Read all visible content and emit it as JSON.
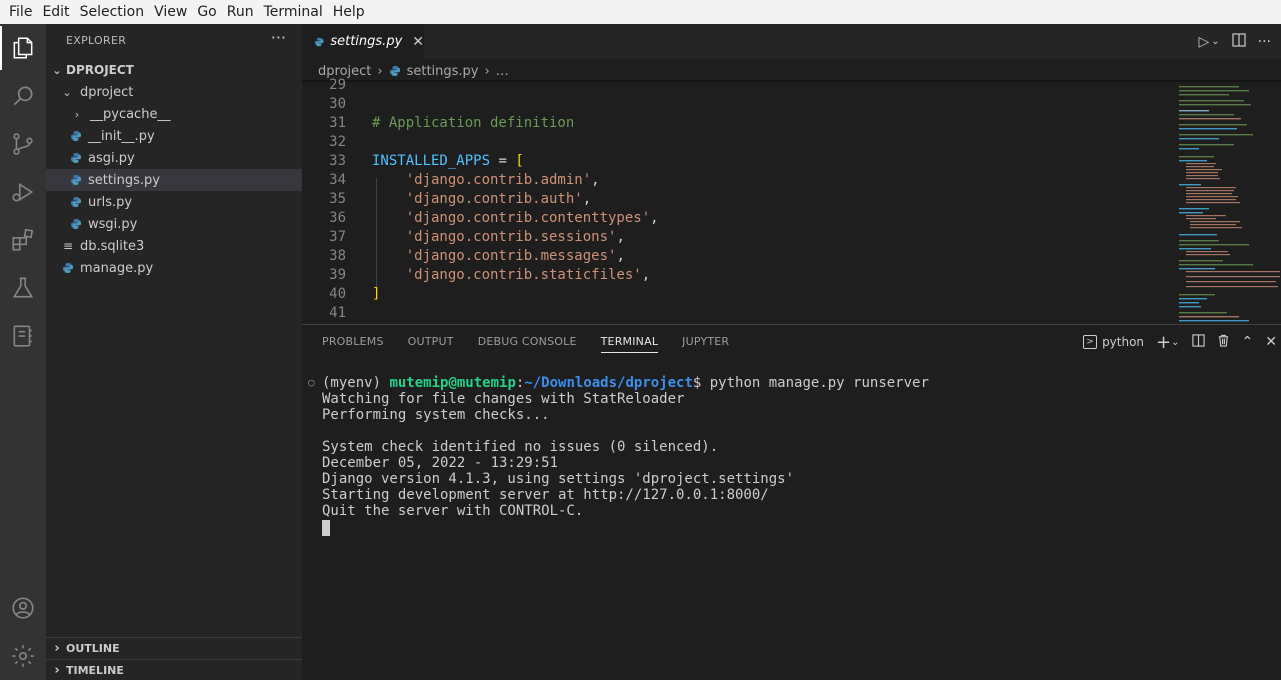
{
  "menu": [
    "File",
    "Edit",
    "Selection",
    "View",
    "Go",
    "Run",
    "Terminal",
    "Help"
  ],
  "activity_bar": {
    "top_icons": [
      "explorer-icon",
      "search-icon",
      "source-control-icon",
      "run-debug-icon",
      "extensions-icon",
      "testing-icon",
      "notebook-icon"
    ],
    "bottom_icons": [
      "account-icon",
      "gear-icon"
    ]
  },
  "sidebar": {
    "title": "EXPLORER",
    "more": "···",
    "root": "DPROJECT",
    "items": [
      {
        "label": "dproject",
        "kind": "folder-open"
      },
      {
        "label": "__pycache__",
        "kind": "folder-closed"
      },
      {
        "label": "__init__.py",
        "kind": "python"
      },
      {
        "label": "asgi.py",
        "kind": "python"
      },
      {
        "label": "settings.py",
        "kind": "python"
      },
      {
        "label": "urls.py",
        "kind": "python"
      },
      {
        "label": "wsgi.py",
        "kind": "python"
      },
      {
        "label": "db.sqlite3",
        "kind": "file"
      },
      {
        "label": "manage.py",
        "kind": "python"
      }
    ],
    "outline": "OUTLINE",
    "timeline": "TIMELINE"
  },
  "editor": {
    "tab_label": "settings.py",
    "breadcrumb": [
      "dproject",
      "settings.py",
      "…"
    ],
    "lines": [
      {
        "n": "29",
        "parts": []
      },
      {
        "n": "30",
        "parts": []
      },
      {
        "n": "31",
        "parts": [
          [
            "comment",
            "# Application definition"
          ]
        ]
      },
      {
        "n": "32",
        "parts": []
      },
      {
        "n": "33",
        "parts": [
          [
            "var",
            "INSTALLED_APPS"
          ],
          [
            "op",
            " = "
          ],
          [
            "bracket",
            "["
          ]
        ]
      },
      {
        "n": "34",
        "parts": [
          [
            "op",
            "    "
          ],
          [
            "str",
            "'django.contrib.admin'"
          ],
          [
            "op",
            ","
          ]
        ]
      },
      {
        "n": "35",
        "parts": [
          [
            "op",
            "    "
          ],
          [
            "str",
            "'django.contrib.auth'"
          ],
          [
            "op",
            ","
          ]
        ]
      },
      {
        "n": "36",
        "parts": [
          [
            "op",
            "    "
          ],
          [
            "str",
            "'django.contrib.contenttypes'"
          ],
          [
            "op",
            ","
          ]
        ]
      },
      {
        "n": "37",
        "parts": [
          [
            "op",
            "    "
          ],
          [
            "str",
            "'django.contrib.sessions'"
          ],
          [
            "op",
            ","
          ]
        ]
      },
      {
        "n": "38",
        "parts": [
          [
            "op",
            "    "
          ],
          [
            "str",
            "'django.contrib.messages'"
          ],
          [
            "op",
            ","
          ]
        ]
      },
      {
        "n": "39",
        "parts": [
          [
            "op",
            "    "
          ],
          [
            "str",
            "'django.contrib.staticfiles'"
          ],
          [
            "op",
            ","
          ]
        ]
      },
      {
        "n": "40",
        "parts": [
          [
            "bracket",
            "]"
          ]
        ]
      },
      {
        "n": "41",
        "parts": []
      }
    ]
  },
  "panel": {
    "tabs": [
      "PROBLEMS",
      "OUTPUT",
      "DEBUG CONSOLE",
      "TERMINAL",
      "JUPYTER"
    ],
    "active_tab": "TERMINAL",
    "terminal_name": "python",
    "prompt": {
      "env": "(myenv) ",
      "user": "mutemip@mutemip",
      "sep": ":",
      "path": "~/Downloads/dproject",
      "symbol": "$ ",
      "command": "python manage.py runserver"
    },
    "output": [
      "Watching for file changes with StatReloader",
      "Performing system checks...",
      "",
      "System check identified no issues (0 silenced).",
      "December 05, 2022 - 13:29:51",
      "Django version 4.1.3, using settings 'dproject.settings'",
      "Starting development server at http://127.0.0.1:8000/",
      "Quit the server with CONTROL-C."
    ]
  },
  "colors": {
    "python_icon": "#3c78aa",
    "comment": "#6a9955",
    "variable": "#4fc1ff",
    "string": "#ce9178",
    "bracket": "#ffd700",
    "terminal_user": "#23d18b",
    "terminal_path": "#3b8eea"
  }
}
